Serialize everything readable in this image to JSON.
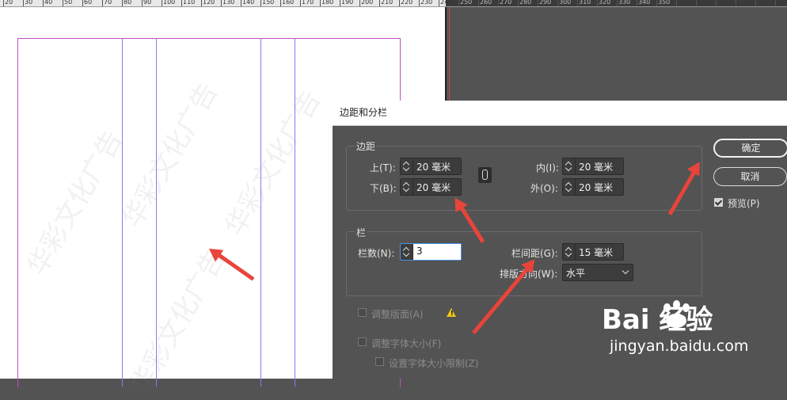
{
  "ruler": {
    "labels": [
      "20",
      "30",
      "40",
      "50",
      "60",
      "70",
      "80",
      "90",
      "100",
      "110",
      "120",
      "130",
      "140",
      "150",
      "160",
      "170",
      "180",
      "190",
      "200",
      "210",
      "220",
      "230",
      "240",
      "250",
      "260",
      "270",
      "280",
      "290",
      "300",
      "310",
      "320",
      "330",
      "340",
      "350"
    ]
  },
  "watermark": {
    "text": "华彩文化广告"
  },
  "dialog": {
    "title": "边距和分栏",
    "margins": {
      "group_label": "边距",
      "top_label": "上(T):",
      "top_value": "20 毫米",
      "bottom_label": "下(B):",
      "bottom_value": "20 毫米",
      "inside_label": "内(I):",
      "inside_value": "20 毫米",
      "outside_label": "外(O):",
      "outside_value": "20 毫米",
      "link_icon": "chain-link-icon"
    },
    "columns": {
      "group_label": "栏",
      "number_label": "栏数(N):",
      "number_value": "3",
      "gutter_label": "栏间距(G):",
      "gutter_value": "15 毫米",
      "writing_direction_label": "排版方向(W):",
      "writing_direction_value": "水平"
    },
    "adjust_layout_label": "调整版面(A)",
    "adjust_font_size_label": "调整字体大小(F)",
    "set_font_size_limit_label": "设置字体大小限制(Z)",
    "ok_label": "确定",
    "cancel_label": "取消",
    "preview_label": "预览(P)",
    "preview_checked": true,
    "warning_icon": "warning-icon"
  },
  "brand": {
    "logo_text": "Bai  经验",
    "url_text": "jingyan.baidu.com"
  },
  "colors": {
    "arrow": "#e8443a",
    "dialog_bg": "#535353",
    "guide": "#8a7cf0",
    "margin": "#c050c0"
  }
}
